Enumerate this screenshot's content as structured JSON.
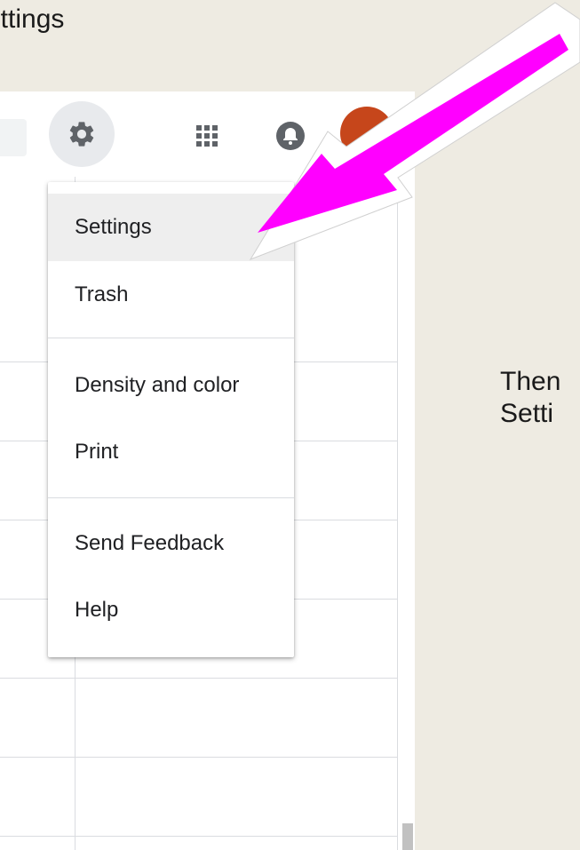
{
  "slide": {
    "title_text": "ettings",
    "note_line1": "Then",
    "note_line2": "Setti"
  },
  "toolbar": {
    "settings_icon": "gear-icon",
    "apps_icon": "apps-grid-icon",
    "notifications_icon": "bell-icon",
    "avatar_color": "#c6461b"
  },
  "menu": {
    "items": [
      {
        "label": "Settings",
        "active": true
      },
      {
        "label": "Trash"
      },
      {
        "label": "Density and color"
      },
      {
        "label": "Print"
      },
      {
        "label": "Send Feedback"
      },
      {
        "label": "Help"
      }
    ]
  },
  "annotation": {
    "arrow_color": "#ff00ff"
  }
}
